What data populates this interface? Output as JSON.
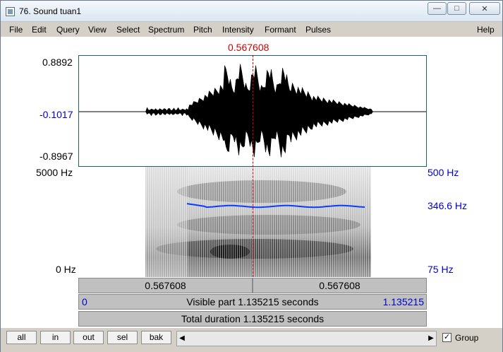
{
  "window": {
    "title": "76. Sound tuan1"
  },
  "menu": [
    "File",
    "Edit",
    "Query",
    "View",
    "Select",
    "Spectrum",
    "Pitch",
    "Intensity",
    "Formant",
    "Pulses",
    "Help"
  ],
  "cursor": {
    "time": "0.567608"
  },
  "waveform": {
    "max": "0.8892",
    "mid": "-0.1017",
    "min": "-0.8967"
  },
  "spectrogram": {
    "top_freq": "5000 Hz",
    "bottom_freq": "0 Hz"
  },
  "pitch": {
    "top": "500 Hz",
    "value": "346.6 Hz",
    "bottom": "75 Hz",
    "color": "#0000cc"
  },
  "time_bars": {
    "left_segment": "0.567608",
    "right_segment": "0.567608",
    "visible_start": "0",
    "visible_label": "Visible part 1.135215 seconds",
    "visible_end": "1.135215",
    "total_label": "Total duration 1.135215 seconds"
  },
  "buttons": {
    "all": "all",
    "in": "in",
    "out": "out",
    "sel": "sel",
    "bak": "bak"
  },
  "group": {
    "label": "Group",
    "checked": true
  },
  "colors": {
    "cursor": "#d00000",
    "axis_blue": "#0000cc"
  }
}
